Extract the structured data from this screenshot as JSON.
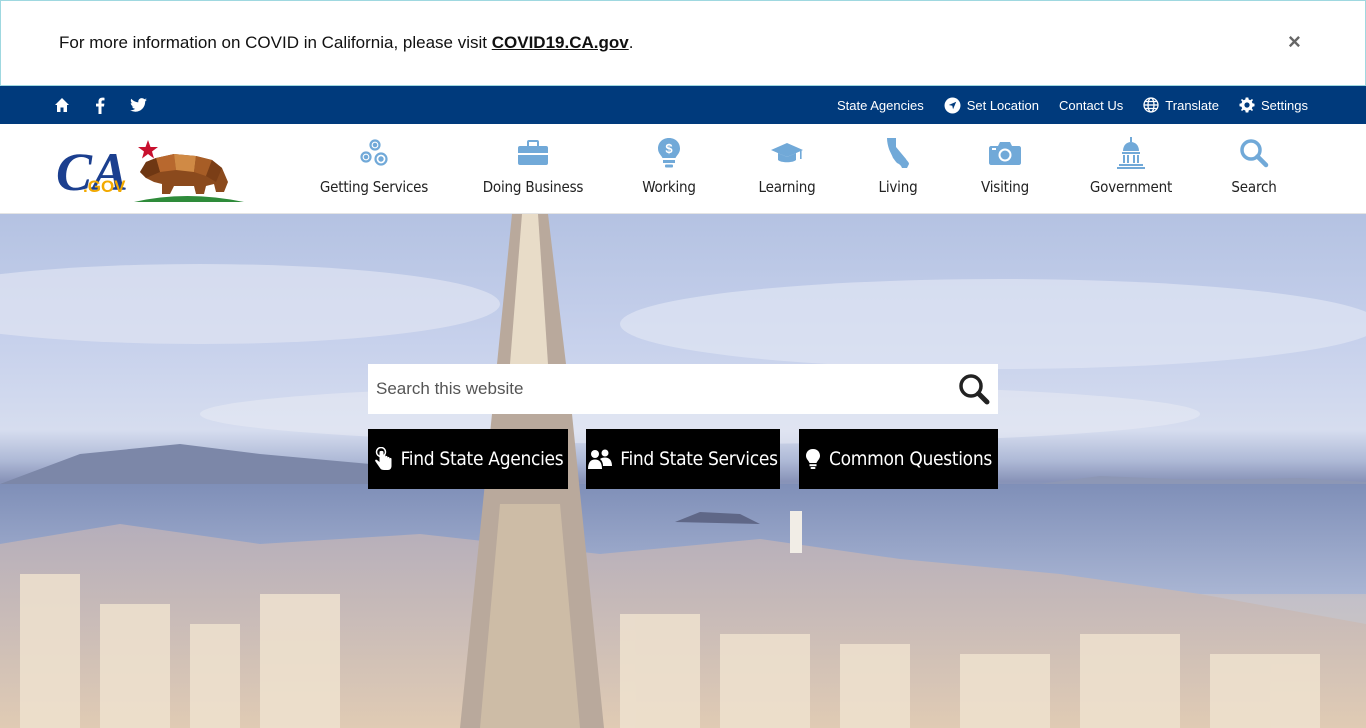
{
  "alert": {
    "text": "For more information on COVID in California, please visit ",
    "link": "COVID19.CA.gov",
    "suffix": ".",
    "close": "×"
  },
  "utility": {
    "social": [
      "home-icon",
      "facebook-icon",
      "twitter-icon"
    ],
    "links": {
      "state_agencies": "State Agencies",
      "set_location": "Set Location",
      "contact_us": "Contact Us",
      "translate": "Translate",
      "settings": "Settings"
    },
    "bg_color": "#003a7c"
  },
  "nav": {
    "items": [
      {
        "label": "Getting Services",
        "icon": "gears-icon"
      },
      {
        "label": "Doing Business",
        "icon": "briefcase-icon"
      },
      {
        "label": "Working",
        "icon": "money-bulb-icon"
      },
      {
        "label": "Learning",
        "icon": "graduation-cap-icon"
      },
      {
        "label": "Living",
        "icon": "california-icon"
      },
      {
        "label": "Visiting",
        "icon": "camera-icon"
      },
      {
        "label": "Government",
        "icon": "capitol-icon"
      },
      {
        "label": "Search",
        "icon": "search-icon"
      }
    ],
    "icon_color": "#71a9d8"
  },
  "hero": {
    "search_placeholder": "Search this website",
    "buttons": {
      "agencies": "Find State Agencies",
      "services": "Find State Services",
      "questions": "Common Questions"
    }
  }
}
